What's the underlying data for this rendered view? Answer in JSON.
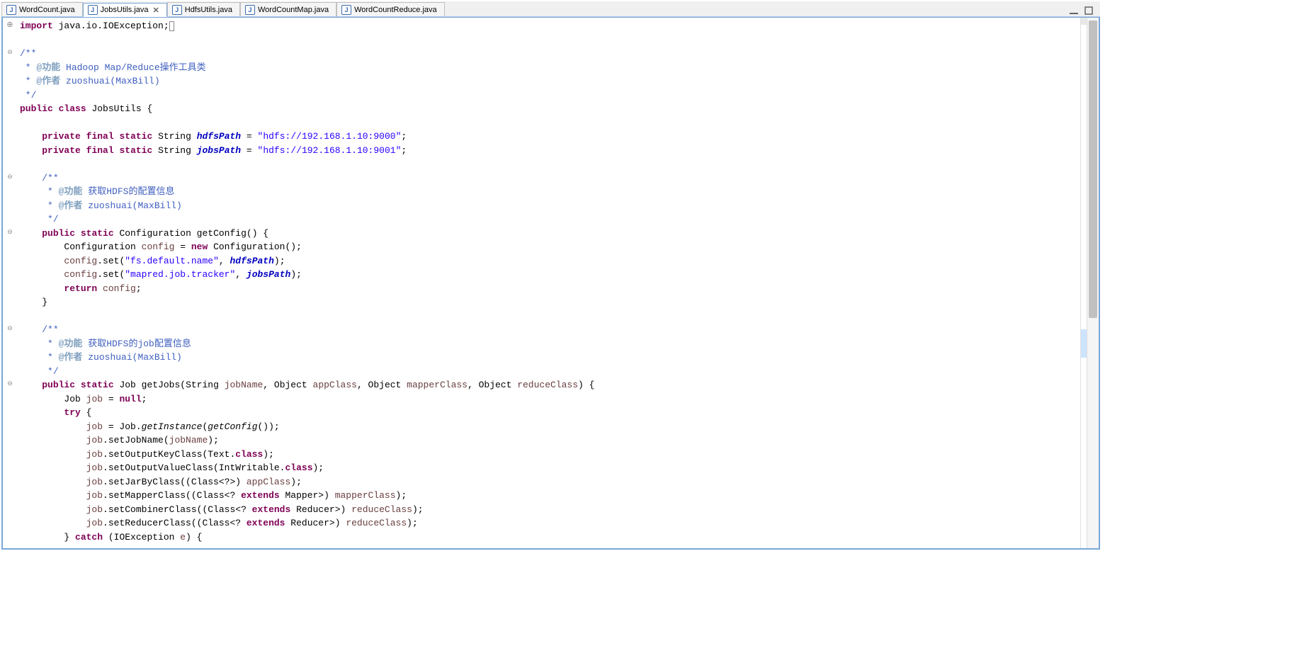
{
  "tabs": [
    {
      "label": "WordCount.java",
      "active": false
    },
    {
      "label": "JobsUtils.java",
      "active": true
    },
    {
      "label": "HdfsUtils.java",
      "active": false
    },
    {
      "label": "WordCountMap.java",
      "active": false
    },
    {
      "label": "WordCountReduce.java",
      "active": false
    }
  ],
  "close_glyph": "✕",
  "j_glyph": "J",
  "toolbar": {
    "minimize_title": "Minimize",
    "maximize_title": "Maximize"
  },
  "code": {
    "import_kw": "import",
    "import_pkg": " java.io.IOException;",
    "doc1_open": "/**",
    "doc1_l1_pre": " * ",
    "doc1_l1_tag": "@功能",
    "doc1_l1_txt": " Hadoop Map/Reduce操作工具类",
    "doc1_l2_pre": " * ",
    "doc1_l2_tag": "@作者",
    "doc1_l2_txt": " zuoshuai(MaxBill)",
    "doc1_close": " */",
    "cls_public": "public",
    "cls_class": "class",
    "cls_name": " JobsUtils {",
    "mod_private": "private",
    "mod_final": "final",
    "mod_static": "static",
    "type_string": " String ",
    "fld_hdfs": "hdfsPath",
    "eq": " = ",
    "str_hdfs": "\"hdfs://192.168.1.10:9000\"",
    "semi": ";",
    "fld_jobs": "jobsPath",
    "str_jobs": "\"hdfs://192.168.1.10:9001\"",
    "doc2_open": "/**",
    "doc2_l1_pre": " * ",
    "doc2_l1_tag": "@功能",
    "doc2_l1_txt": " 获取HDFS的配置信息",
    "doc2_l2_pre": " * ",
    "doc2_l2_tag": "@作者",
    "doc2_l2_txt": " zuoshuai(MaxBill)",
    "doc2_close": " */",
    "ret_conf": " Configuration getConfig() {",
    "conf_decl_a": "Configuration ",
    "conf_var": "config",
    "conf_decl_b": " = ",
    "kw_new": "new",
    "conf_decl_c": " Configuration();",
    "set1_a": ".set(",
    "set1_key": "\"fs.default.name\"",
    "set1_b": ", ",
    "set1_c": ");",
    "set2_key": "\"mapred.job.tracker\"",
    "kw_return": "return",
    "ret_c": ";",
    "brace_close": "}",
    "doc3_open": "/**",
    "doc3_l1_pre": " * ",
    "doc3_l1_tag": "@功能",
    "doc3_l1_txt": " 获取HDFS的job配置信息",
    "doc3_l2_pre": " * ",
    "doc3_l2_tag": "@作者",
    "doc3_l2_txt": " zuoshuai(MaxBill)",
    "doc3_close": " */",
    "kw_public": "public",
    "kw_static": "static",
    "gj_a": " Job getJobs(String ",
    "p_jobname": "jobName",
    "gj_b": ", Object ",
    "p_appclass": "appClass",
    "p_mapper": "mapperClass",
    "p_reduce": "reduceClass",
    "gj_c": ") {",
    "job_decl_a": "Job ",
    "v_job": "job",
    "kw_null": "null",
    "kw_try": "try",
    "try_b": " {",
    "gi_a": " = Job.",
    "gi_m": "getInstance",
    "gi_b": "(",
    "gi_c": "getConfig",
    "gi_d": "());",
    "sjn_a": ".setJobName(",
    "sjn_b": ");",
    "sok_a": ".setOutputKeyClass(Text.",
    "kw_classlit": "class",
    "sok_b": ");",
    "sov_a": ".setOutputValueClass(IntWritable.",
    "sjb_a": ".setJarByClass((Class<?>) ",
    "smc_a": ".setMapperClass((Class<? ",
    "kw_extends": "extends",
    "smc_b": " Mapper>) ",
    "scc_a": ".setCombinerClass((Class<? ",
    "scc_b": " Reducer>) ",
    "src_a": ".setReducerClass((Class<? ",
    "catch_a": "} ",
    "kw_catch": "catch",
    "catch_b": " (IOException ",
    "v_e": "e",
    "catch_c": ") {"
  }
}
